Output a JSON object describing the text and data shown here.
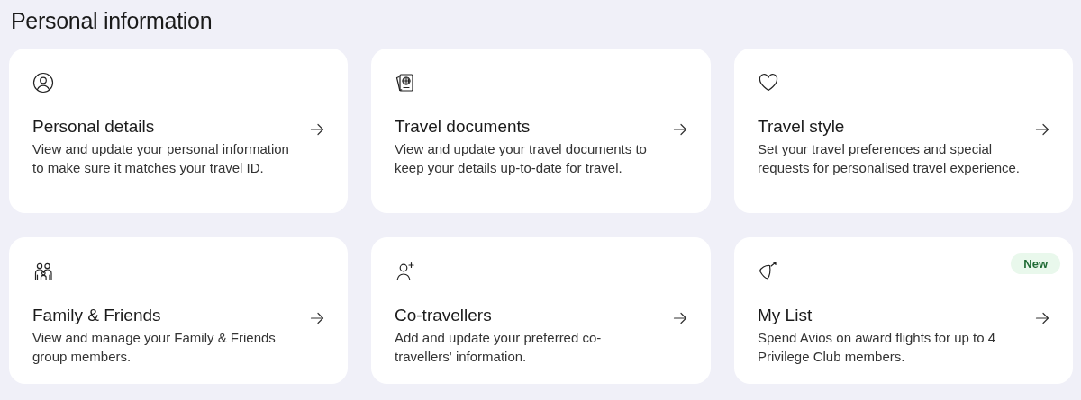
{
  "page_title": "Personal information",
  "cards": [
    {
      "title": "Personal details",
      "description": "View and update your personal information to make sure it matches your travel ID."
    },
    {
      "title": "Travel documents",
      "description": "View and update your travel documents to keep your details up-to-date for travel."
    },
    {
      "title": "Travel style",
      "description": "Set your travel preferences and special requests for personalised travel experience."
    },
    {
      "title": "Family & Friends",
      "description": "View and manage your Family & Friends group members."
    },
    {
      "title": "Co-travellers",
      "description": "Add and update your preferred co-travellers' information."
    },
    {
      "title": "My List",
      "description": "Spend Avios on award flights for up to 4 Privilege Club members.",
      "badge": "New"
    }
  ]
}
